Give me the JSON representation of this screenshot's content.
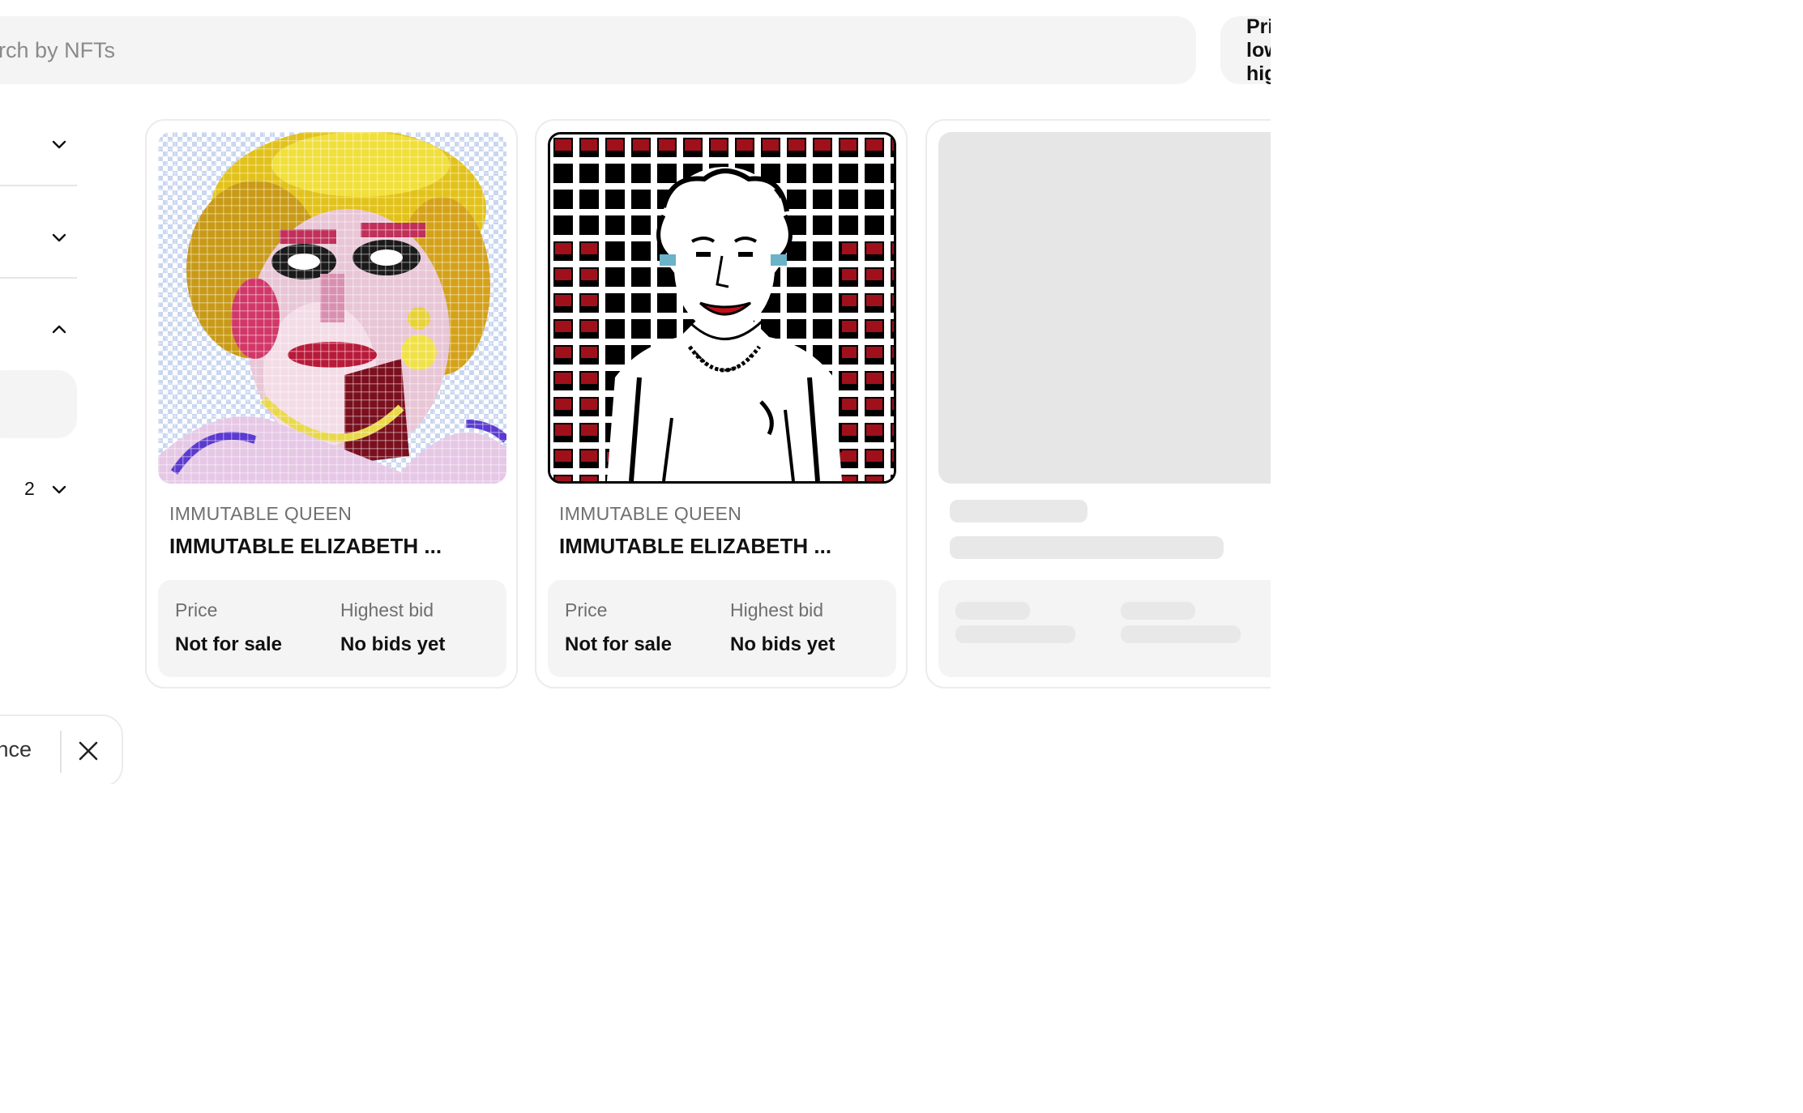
{
  "search": {
    "placeholder": "Search by NFTs"
  },
  "sort": {
    "label": "Price: low to high"
  },
  "sidebar": {
    "sections": [
      {
        "state": "collapsed"
      },
      {
        "state": "collapsed"
      },
      {
        "state": "expanded"
      },
      {
        "count": "2",
        "state": "collapsed"
      }
    ],
    "active_filter_chip": {
      "label": "Rarity: Licence"
    }
  },
  "cards": [
    {
      "collection": "IMMUTABLE QUEEN",
      "title": "IMMUTABLE ELIZABETH ...",
      "price_label": "Price",
      "price_value": "Not for sale",
      "bid_label": "Highest bid",
      "bid_value": "No bids yet"
    },
    {
      "collection": "IMMUTABLE QUEEN",
      "title": "IMMUTABLE ELIZABETH ...",
      "price_label": "Price",
      "price_value": "Not for sale",
      "bid_label": "Highest bid",
      "bid_value": "No bids yet"
    }
  ],
  "colors": {
    "background": "#ffffff",
    "surface": "#f4f4f4",
    "border": "#ececec",
    "muted_text": "#6f6f6f",
    "skeleton": "#e8e8e8"
  }
}
